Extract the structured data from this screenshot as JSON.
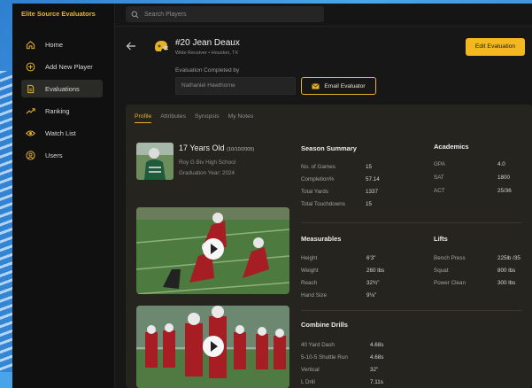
{
  "app": {
    "brand": "Elite Source Evaluators"
  },
  "search": {
    "placeholder": "Search Players"
  },
  "sidebar": {
    "items": [
      {
        "label": "Home",
        "icon": "home-icon"
      },
      {
        "label": "Add New Player",
        "icon": "plus-circle-icon"
      },
      {
        "label": "Evaluations",
        "icon": "document-icon",
        "active": true
      },
      {
        "label": "Ranking",
        "icon": "trend-icon"
      },
      {
        "label": "Watch List",
        "icon": "eye-icon"
      },
      {
        "label": "Users",
        "icon": "user-icon"
      }
    ]
  },
  "player": {
    "name": "#20 Jean Deaux",
    "subtitle": "Wide Receiver • Houston, TX",
    "age": "17 Years Old",
    "dob": "(10/10/2005)",
    "school": "Roy G Biv High School",
    "graduation": "Graduation Year: 2024"
  },
  "actions": {
    "edit_label": "Edit Evaluation",
    "email_label": "Email Evaluator"
  },
  "evaluation": {
    "label": "Evaluation Completed by",
    "evaluator": "Nathaniel Hawthorne"
  },
  "tabs": [
    "Profile",
    "Attributes",
    "Synopsis",
    "My Notes"
  ],
  "season_summary": {
    "title": "Season Summary",
    "rows": [
      {
        "k": "No. of Games",
        "v": "15"
      },
      {
        "k": "Completion%",
        "v": "57.14"
      },
      {
        "k": "Total Yards",
        "v": "1337"
      },
      {
        "k": "Total Touchdowns",
        "v": "15"
      }
    ]
  },
  "academics": {
    "title": "Academics",
    "rows": [
      {
        "k": "GPA",
        "v": "4.0"
      },
      {
        "k": "SAT",
        "v": "1800"
      },
      {
        "k": "ACT",
        "v": "25/36"
      }
    ]
  },
  "measurables": {
    "title": "Measurables",
    "rows": [
      {
        "k": "Height",
        "v": "6'3\""
      },
      {
        "k": "Weight",
        "v": "260 lbs"
      },
      {
        "k": "Reach",
        "v": "32¾\""
      },
      {
        "k": "Hand Size",
        "v": "9⅛\""
      }
    ]
  },
  "lifts": {
    "title": "Lifts",
    "rows": [
      {
        "k": "Bench Press",
        "v": "225lb /35"
      },
      {
        "k": "Squat",
        "v": "800 lbs"
      },
      {
        "k": "Power Clean",
        "v": "300 lbs"
      }
    ]
  },
  "combine": {
    "title": "Combine Drills",
    "rows": [
      {
        "k": "40 Yard Dash",
        "v": "4.68s"
      },
      {
        "k": "5-10-5 Shuttle Run",
        "v": "4.68s"
      },
      {
        "k": "Vertical",
        "v": "32\""
      },
      {
        "k": "L Drill",
        "v": "7.11s"
      }
    ]
  },
  "colors": {
    "accent": "#f3b71f",
    "panel": "#26241e",
    "background": "#141414"
  }
}
